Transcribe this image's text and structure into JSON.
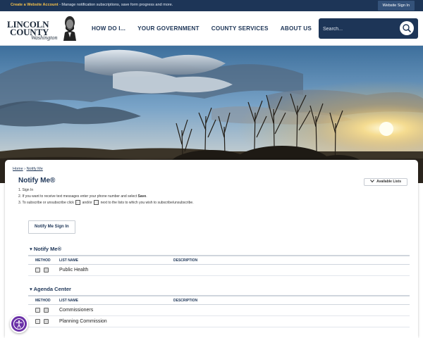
{
  "topbar": {
    "create_link": "Create a Website Account",
    "create_rest": " - Manage notification subscriptions, save form progress and more.",
    "signin": "Website Sign In"
  },
  "logo": {
    "line1": "LINCOLN",
    "line2": "COUNTY",
    "line3": "Washington"
  },
  "nav": [
    "HOW DO I...",
    "YOUR GOVERNMENT",
    "COUNTY SERVICES",
    "ABOUT US"
  ],
  "search": {
    "placeholder": "Search..."
  },
  "breadcrumb": {
    "home": "Home",
    "separator": " › ",
    "current": "Notify Me"
  },
  "page": {
    "title": "Notify Me®",
    "available_lists": "Available Lists",
    "step1": "1. Sign In",
    "step2_pre": "2. If you want to receive text messages enter your phone number and select ",
    "step2_bold": "Save",
    "step2_post": ".",
    "step3_pre": "3. To subscribe or unsubscribe click ",
    "step3_mid": " and/or ",
    "step3_post": " next to the lists to which you wish to subscribe/unsubscribe.",
    "signin_button": "Notify Me Sign In"
  },
  "columns": {
    "method": "METHOD",
    "list_name": "LIST NAME",
    "description": "DESCRIPTION"
  },
  "sections": [
    {
      "title": "▾ Notify Me®",
      "rows": [
        {
          "name": "Public Health"
        }
      ]
    },
    {
      "title": "▾ Agenda Center",
      "rows": [
        {
          "name": "Commissioners"
        },
        {
          "name": "Planning Commission"
        }
      ]
    }
  ],
  "colors": {
    "navy": "#1d3557",
    "gold": "#f5c14b",
    "a11y": "#6b31a8"
  },
  "icons": [
    "search-icon",
    "email-icon",
    "sms-icon",
    "accessibility-icon",
    "chevron-down-icon"
  ]
}
